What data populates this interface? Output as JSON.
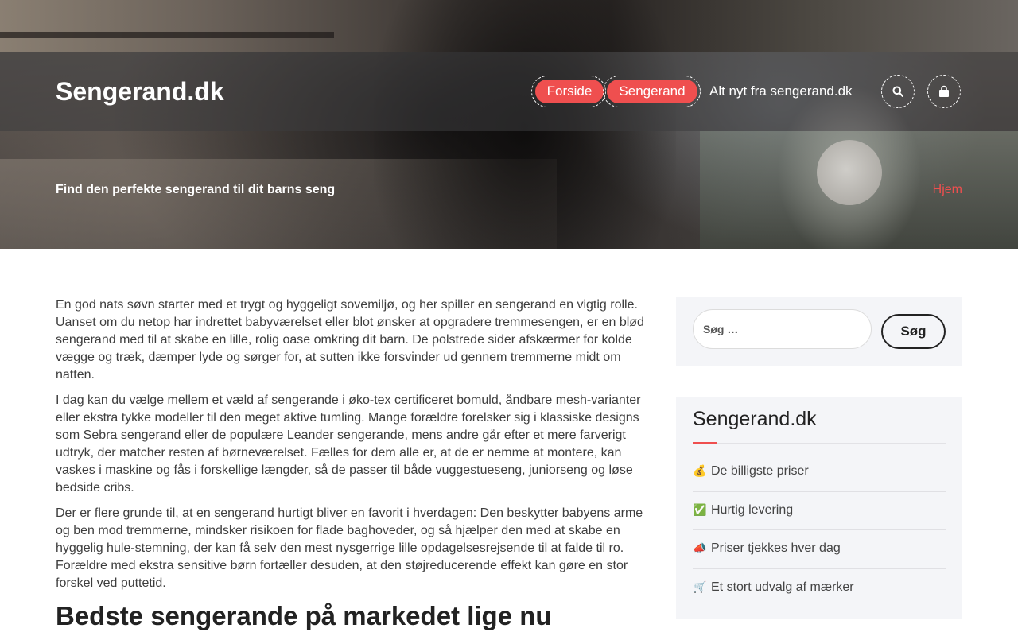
{
  "site": {
    "brand": "Sengerand.dk",
    "nav": {
      "item1": "Forside",
      "item2": "Sengerand",
      "item3": "Alt nyt fra sengerand.dk"
    },
    "icons": {
      "search": "search-icon",
      "cart": "shopping-bag-icon"
    },
    "accent_color": "#ef4f4f"
  },
  "hero": {
    "tagline": "Find den perfekte sengerand til dit barns seng",
    "breadcrumb": "Hjem"
  },
  "content": {
    "p1": "En god nats søvn starter med et trygt og hyggeligt sovemiljø, og her spiller en sengerand en vigtig rolle. Uanset om du netop har indrettet babyværelset eller blot ønsker at opgradere tremmesengen, er en blød sengerand med til at skabe en lille, rolig oase omkring dit barn. De polstrede sider afskærmer for kolde vægge og træk, dæmper lyde og sørger for, at sutten ikke forsvinder ud gennem tremmerne midt om natten.",
    "p2": "I dag kan du vælge mellem et væld af sengerande i øko-tex certificeret bomuld, åndbare mesh-varianter eller ekstra tykke modeller til den meget aktive tumling. Mange forældre forelsker sig i klassiske designs som Sebra sengerand eller de populære Leander sengerande, mens andre går efter et mere farverigt udtryk, der matcher resten af børneværelset. Fælles for dem alle er, at de er nemme at montere, kan vaskes i maskine og fås i forskellige længder, så de passer til både vuggestueseng, juniorseng og løse bedside cribs.",
    "p3": "Der er flere grunde til, at en sengerand hurtigt bliver en favorit i hverdagen: Den beskytter babyens arme og ben mod tremmerne, mindsker risikoen for flade baghoveder, og så hjælper den med at skabe en hyggelig hule-stemning, der kan få selv den mest nysgerrige lille opdagelsesrejsende til at falde til ro. Forældre med ekstra sensitive børn fortæller desuden, at den støjreducerende effekt kan gøre en stor forskel ved puttetid.",
    "heading": "Bedste sengerande på markedet lige nu"
  },
  "sidebar": {
    "search": {
      "placeholder": "Søg …",
      "button": "Søg"
    },
    "widget_title": "Sengerand.dk",
    "items": [
      {
        "emoji": "💰",
        "text": "De billigste priser"
      },
      {
        "emoji": "✅",
        "text": "Hurtig levering"
      },
      {
        "emoji": "📣",
        "text": "Priser tjekkes hver dag"
      },
      {
        "emoji": "🛒",
        "text": "Et stort udvalg af mærker"
      }
    ]
  }
}
